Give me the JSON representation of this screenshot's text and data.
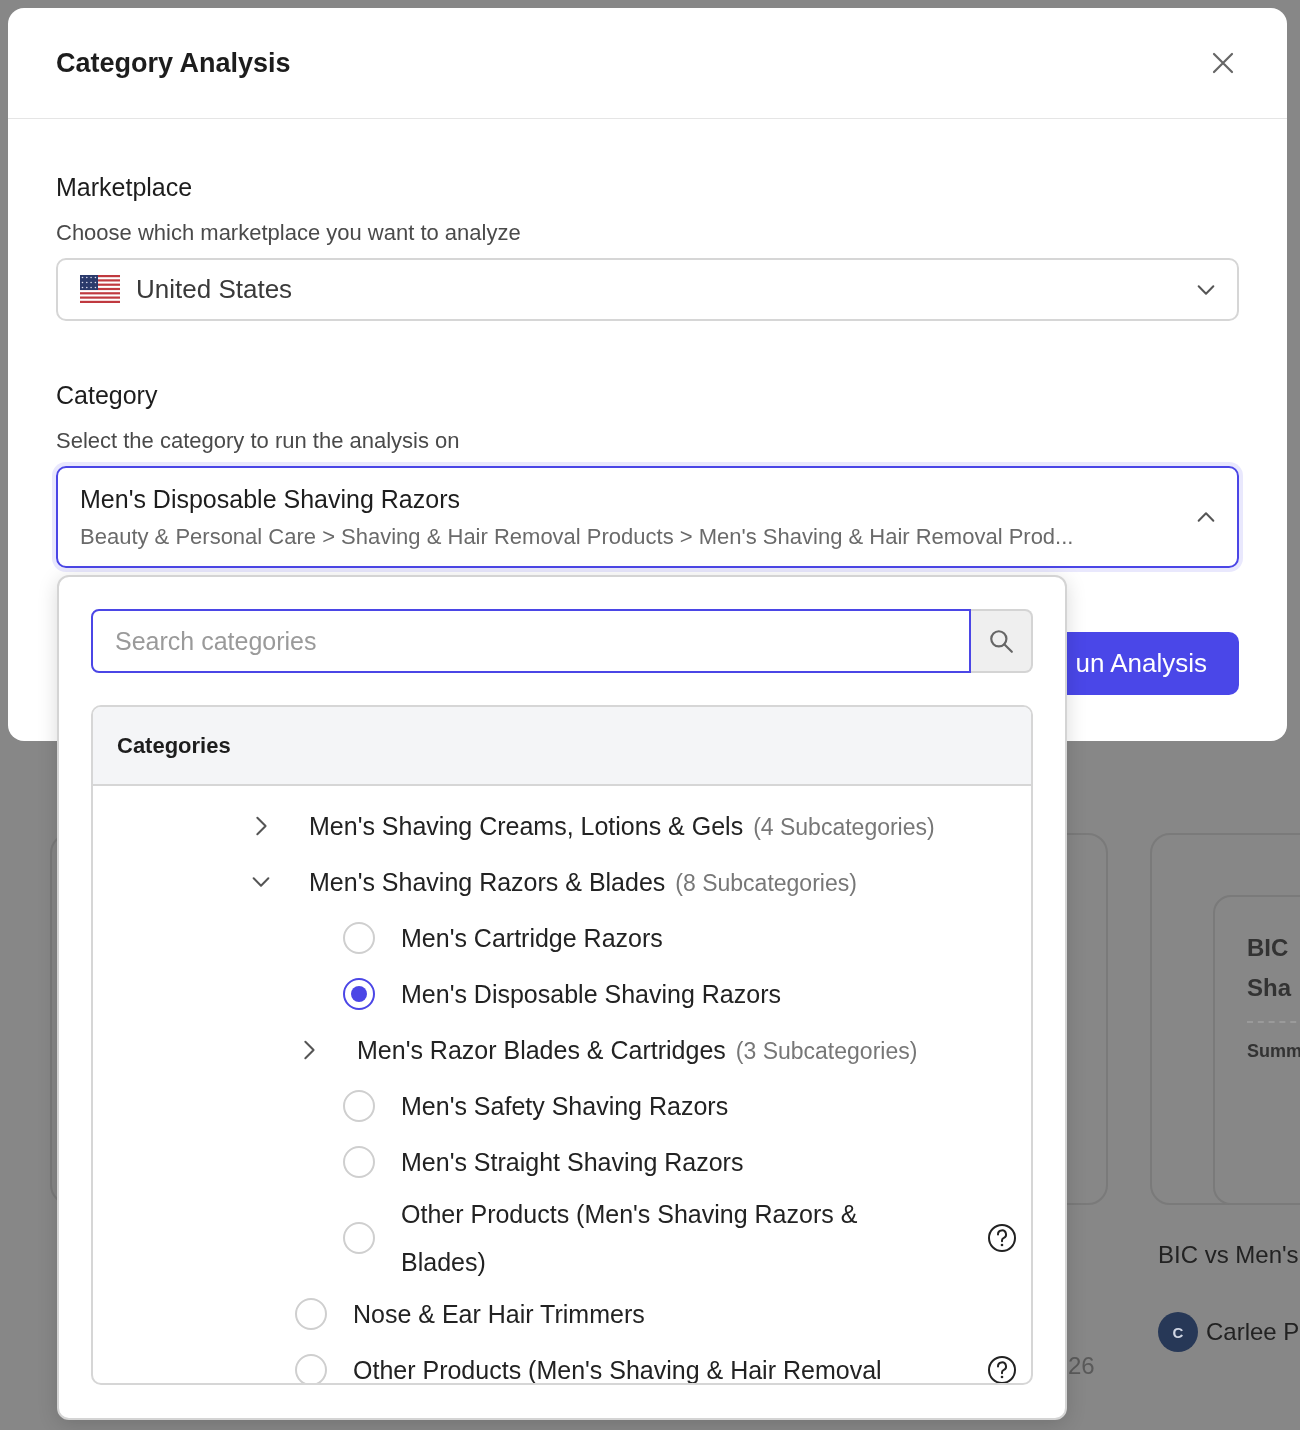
{
  "background": {
    "card": {
      "title_lines": [
        "BIC",
        "Sha"
      ],
      "section": "Summ"
    },
    "report_title": "BIC vs Men's",
    "author": {
      "initial": "C",
      "name": "Carlee P"
    },
    "date_fragment": "26"
  },
  "modal": {
    "title": "Category Analysis",
    "marketplace": {
      "label": "Marketplace",
      "description": "Choose which marketplace you want to analyze",
      "value": "United States"
    },
    "category": {
      "label": "Category",
      "description": "Select the category to run the analysis on",
      "value": "Men's Disposable Shaving Razors",
      "path": "Beauty & Personal Care > Shaving & Hair Removal Products > Men's Shaving & Hair Removal Prod...",
      "expanded": true
    },
    "run_button": "un Analysis"
  },
  "dropdown": {
    "search": {
      "placeholder": "Search categories"
    },
    "panel_title": "Categories",
    "items": [
      {
        "kind": "group",
        "label": "Men's Shaving Creams, Lotions & Gels",
        "count": "(4 Subcategories)",
        "expanded": false
      },
      {
        "kind": "group",
        "label": "Men's Shaving Razors & Blades",
        "count": "(8 Subcategories)",
        "expanded": true,
        "children": [
          {
            "kind": "option",
            "label": "Men's Cartridge Razors",
            "selected": false
          },
          {
            "kind": "option",
            "label": "Men's Disposable Shaving Razors",
            "selected": true
          },
          {
            "kind": "group",
            "label": "Men's Razor Blades & Cartridges",
            "count": "(3 Subcategories)",
            "expanded": false
          },
          {
            "kind": "option",
            "label": "Men's Safety Shaving Razors",
            "selected": false
          },
          {
            "kind": "option",
            "label": "Men's Straight Shaving Razors",
            "selected": false
          },
          {
            "kind": "option",
            "label": "Other Products (Men's Shaving Razors & Blades)",
            "selected": false,
            "help": true
          }
        ]
      },
      {
        "kind": "option",
        "label": "Nose & Ear Hair Trimmers",
        "selected": false
      },
      {
        "kind": "option",
        "label": "Other Products (Men's Shaving & Hair Removal",
        "selected": false,
        "help": true
      }
    ]
  }
}
